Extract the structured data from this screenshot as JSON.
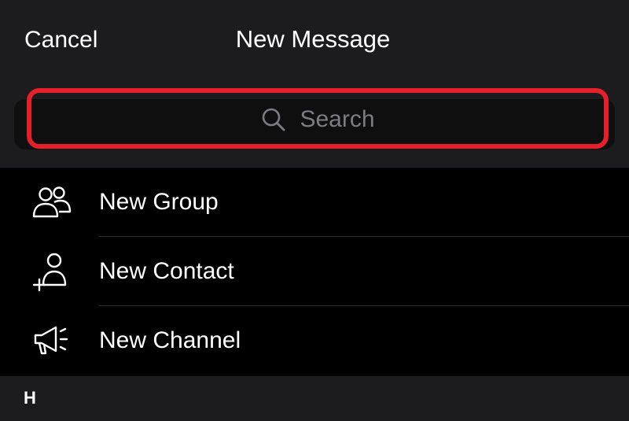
{
  "header": {
    "cancel_label": "Cancel",
    "title": "New Message"
  },
  "search": {
    "placeholder": "Search",
    "icon": "search-icon",
    "highlight_color": "#e5202a"
  },
  "menu": {
    "items": [
      {
        "label": "New Group",
        "icon": "people-icon"
      },
      {
        "label": "New Contact",
        "icon": "add-person-icon"
      },
      {
        "label": "New Channel",
        "icon": "megaphone-icon"
      }
    ]
  },
  "section": {
    "letter": "H"
  },
  "colors": {
    "background": "#000000",
    "header_bg": "#1c1c1e",
    "text": "#ffffff",
    "placeholder": "#7c7c82"
  }
}
